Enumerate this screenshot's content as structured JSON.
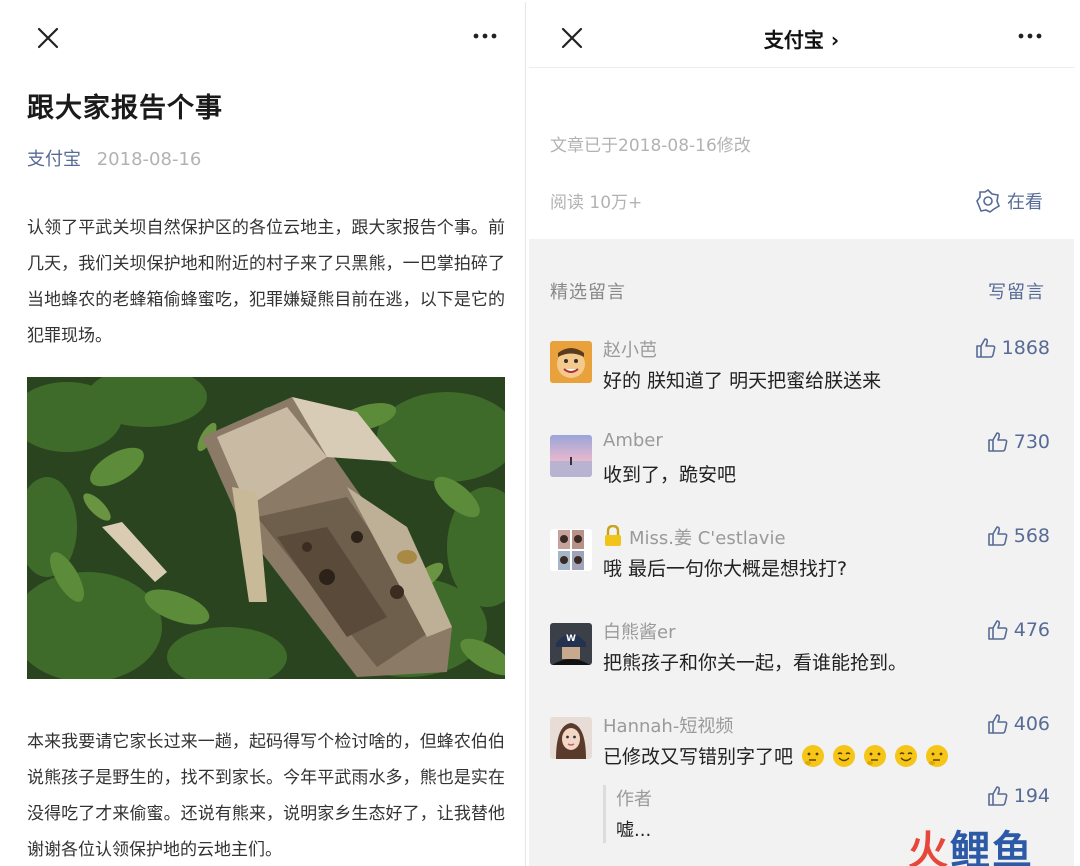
{
  "left": {
    "title": "跟大家报告个事",
    "author": "支付宝",
    "date": "2018-08-16",
    "paragraph1": "认领了平武关坝自然保护区的各位云地主，跟大家报告个事。前几天，我们关坝保护地和附近的村子来了只黑熊，一巴掌拍碎了当地蜂农的老蜂箱偷蜂蜜吃，犯罪嫌疑熊目前在逃，以下是它的犯罪现场。",
    "paragraph2": "本来我要请它家长过来一趟，起码得写个检讨啥的，但蜂农伯伯说熊孩子是野生的，找不到家长。今年平武雨水多，熊也是实在没得吃了才来偷蜜。还说有熊来，说明家乡生态好了，让我替他谢谢各位认领保护地的云地主们。"
  },
  "right": {
    "nav_title": "支付宝 ›",
    "modified": "文章已于2018-08-16修改",
    "read_count": "阅读 10万+",
    "zaikan": "在看",
    "section_title": "精选留言",
    "write_comment": "写留言",
    "comments": [
      {
        "nick": "赵小芭",
        "text": "好的 朕知道了 明天把蜜给朕送来",
        "likes": "1868"
      },
      {
        "nick": "Amber",
        "text": "收到了，跪安吧",
        "likes": "730"
      },
      {
        "nick": "Miss.姜 C'estlavie",
        "text": "哦 最后一句你大概是想找打?",
        "likes": "568"
      },
      {
        "nick": "白熊酱er",
        "text": "把熊孩子和你关一起，看谁能抢到。",
        "likes": "476"
      },
      {
        "nick": "Hannah-短视频",
        "text": "已修改又写错别字了吧",
        "likes": "406"
      }
    ],
    "reply": {
      "name": "作者",
      "text": "嘘...",
      "likes": "194"
    }
  },
  "watermark": {
    "part1": "火",
    "part2": "鲤鱼"
  }
}
